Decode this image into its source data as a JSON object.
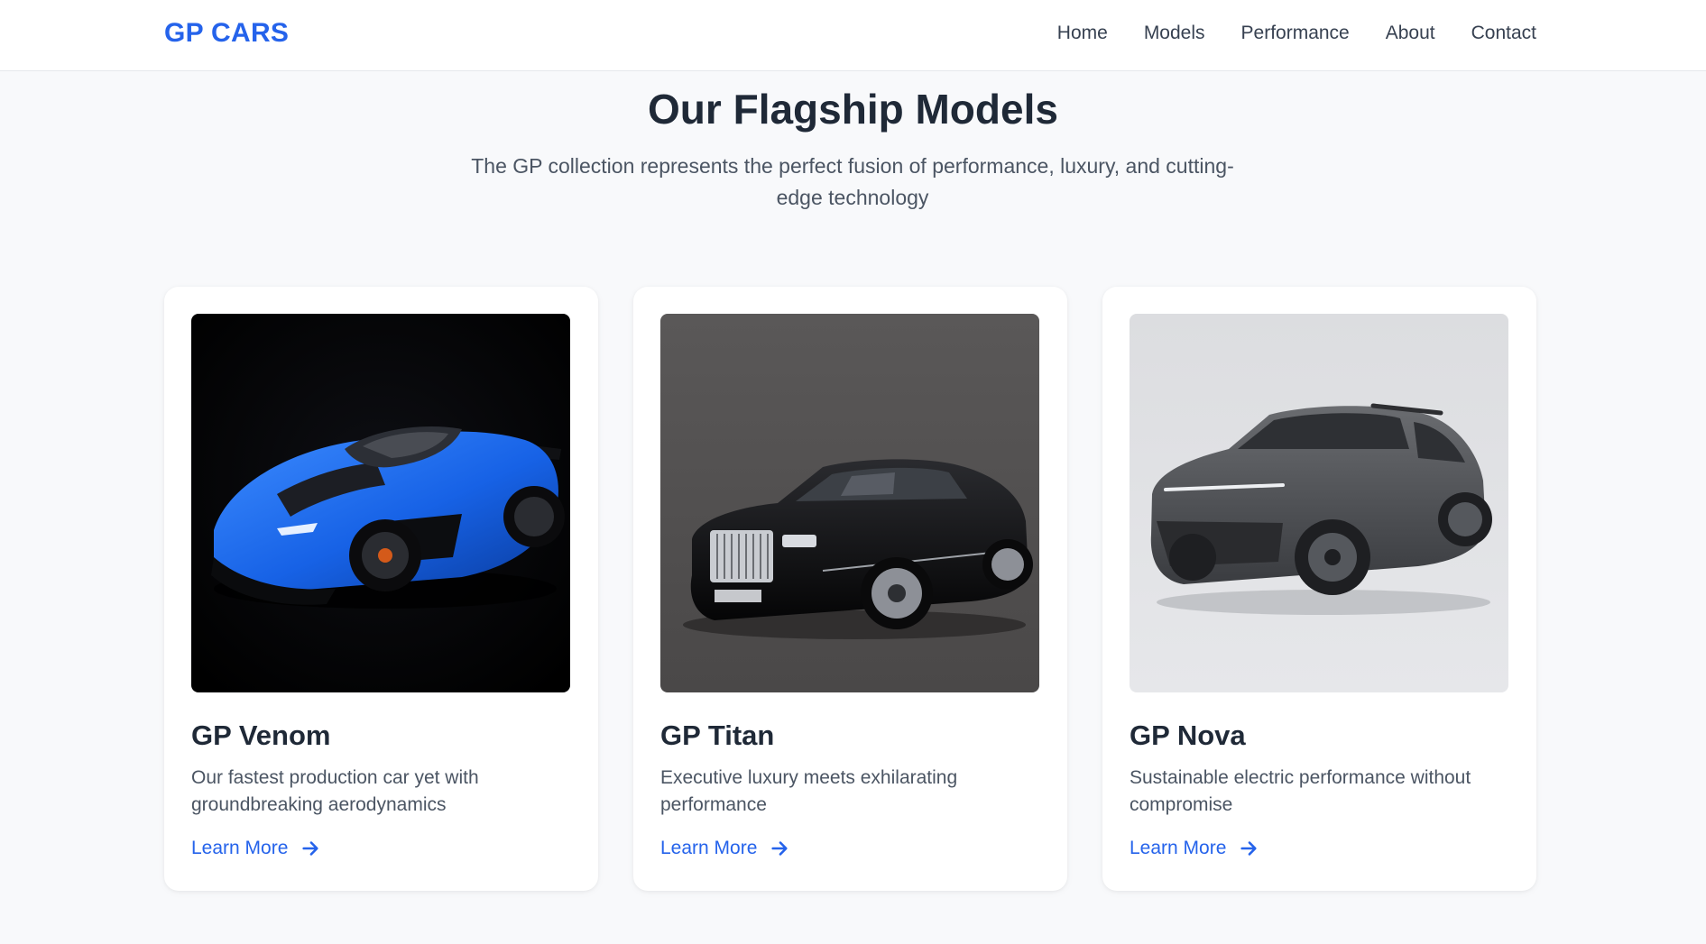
{
  "brand": "GP CARS",
  "nav": {
    "items": [
      "Home",
      "Models",
      "Performance",
      "About",
      "Contact"
    ]
  },
  "section": {
    "title": "Our Flagship Models",
    "subtitle": "The GP collection represents the perfect fusion of performance, luxury, and cutting-edge technology"
  },
  "cards": [
    {
      "title": "GP Venom",
      "description": "Our fastest production car yet with groundbreaking aerodynamics",
      "link": "Learn More",
      "image_desc": "blue hypercar on black background",
      "colors": {
        "bg": "#020203",
        "body": "#1a6bf0"
      }
    },
    {
      "title": "GP Titan",
      "description": "Executive luxury meets exhilarating performance",
      "link": "Learn More",
      "image_desc": "black luxury sedan on dark grey background",
      "colors": {
        "bg": "#5a5858",
        "body": "#0d0d0f"
      }
    },
    {
      "title": "GP Nova",
      "description": "Sustainable electric performance without compromise",
      "link": "Learn More",
      "image_desc": "grey electric SUV on light grey background",
      "colors": {
        "bg": "#dcdde0",
        "body": "#4b4d50"
      }
    }
  ],
  "colors": {
    "accent": "#2563eb",
    "heading": "#1f2937",
    "body_text": "#4b5563",
    "page_bg": "#f8f9fb"
  }
}
